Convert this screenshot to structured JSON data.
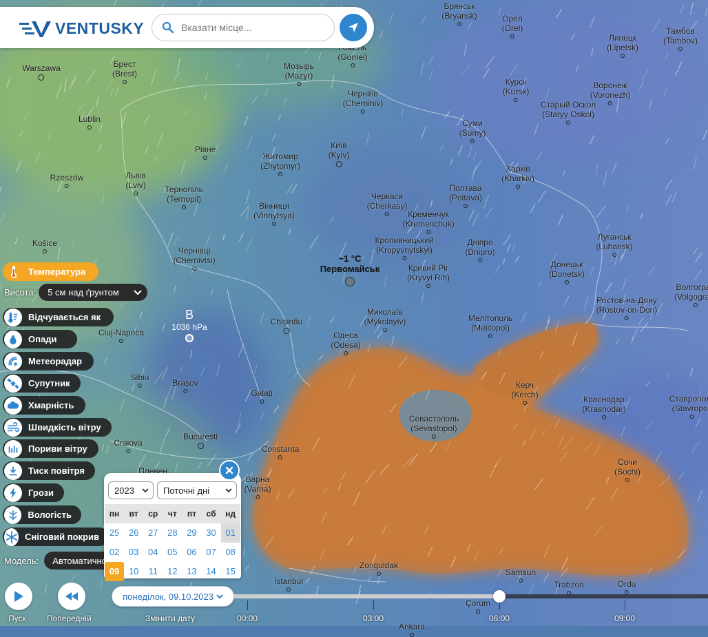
{
  "header": {
    "logo_text": "VENTUSKY",
    "search_placeholder": "Вказати місце..."
  },
  "layers": {
    "active": "Температура",
    "height_label": "Висота:",
    "height_value": "5 см над ґрунтом",
    "items": [
      {
        "label": "Відчувається як",
        "icon": "feels-like-icon"
      },
      {
        "label": "Опади",
        "icon": "precipitation-icon"
      },
      {
        "label": "Метеорадар",
        "icon": "radar-icon"
      },
      {
        "label": "Супутник",
        "icon": "satellite-icon"
      },
      {
        "label": "Хмарність",
        "icon": "cloud-icon"
      },
      {
        "label": "Швидкість вітру",
        "icon": "wind-icon"
      },
      {
        "label": "Пориви вітру",
        "icon": "gust-icon"
      },
      {
        "label": "Тиск повітря",
        "icon": "pressure-icon"
      },
      {
        "label": "Грози",
        "icon": "lightning-icon"
      },
      {
        "label": "Вологість",
        "icon": "humidity-icon"
      },
      {
        "label": "Сніговий покрив",
        "icon": "snowflake-icon"
      }
    ],
    "model_label": "Модель:",
    "model_value": "Автоматично"
  },
  "calendar": {
    "year": "2023",
    "range": "Поточні дні",
    "weekdays": [
      "пн",
      "вт",
      "ср",
      "чт",
      "пт",
      "сб",
      "нд"
    ],
    "weeks": [
      [
        "25",
        "26",
        "27",
        "28",
        "29",
        "30",
        "01"
      ],
      [
        "02",
        "03",
        "04",
        "05",
        "06",
        "07",
        "08"
      ],
      [
        "09",
        "10",
        "11",
        "12",
        "13",
        "14",
        "15"
      ]
    ],
    "today": "09"
  },
  "timeline": {
    "play_label": "Пуск",
    "prev_label": "Попередній",
    "change_date_label": "Змінити дату",
    "date": "понеділок, 09.10.2023",
    "ticks": [
      "00:00",
      "03:00",
      "06:00",
      "09:00"
    ],
    "current_position_fraction": 0.56
  },
  "map": {
    "probe_temp": "−1 °C",
    "probe_city": "Первомайськ",
    "pressure_letter": "В",
    "pressure_value": "1036 hPa",
    "cities": [
      {
        "name": "Брянськ",
        "latin": "(Bryansk)"
      },
      {
        "name": "Орёл",
        "latin": "(Orel)"
      },
      {
        "name": "Липецк",
        "latin": "(Lipetsk)"
      },
      {
        "name": "Тамбов",
        "latin": "(Tambov)"
      },
      {
        "name": "Гомель",
        "latin": "(Gomel)"
      },
      {
        "name": "Warszawa",
        "latin": ""
      },
      {
        "name": "Брест",
        "latin": "(Brest)"
      },
      {
        "name": "Мозырь",
        "latin": "(Mazyr)"
      },
      {
        "name": "Чернігів",
        "latin": "(Chernihiv)"
      },
      {
        "name": "Курск",
        "latin": "(Kursk)"
      },
      {
        "name": "Воронеж",
        "latin": "(Voronezh)"
      },
      {
        "name": "Старый Оскол",
        "latin": "(Staryy Oskol)"
      },
      {
        "name": "Суми",
        "latin": "(Sumy)"
      },
      {
        "name": "Lublin",
        "latin": ""
      },
      {
        "name": "Рівне",
        "latin": ""
      },
      {
        "name": "Житомир",
        "latin": "(Zhytomyr)"
      },
      {
        "name": "Київ",
        "latin": "(Kyiv)"
      },
      {
        "name": "Харків",
        "latin": "(Kharkiv)"
      },
      {
        "name": "Rzeszów",
        "latin": ""
      },
      {
        "name": "Львів",
        "latin": "(Lviv)"
      },
      {
        "name": "Тернопіль",
        "latin": "(Ternopil)"
      },
      {
        "name": "Черкаси",
        "latin": "(Cherkasy)"
      },
      {
        "name": "Полтава",
        "latin": "(Poltava)"
      },
      {
        "name": "Вінниця",
        "latin": "(Vinnytsya)"
      },
      {
        "name": "Кременчук",
        "latin": "(Kremenchuk)"
      },
      {
        "name": "Кропивницький",
        "latin": "(Kropyvnytskyi)"
      },
      {
        "name": "Дніпро",
        "latin": "(Dnipro)"
      },
      {
        "name": "Луганськ",
        "latin": "(Luhansk)"
      },
      {
        "name": "Košice",
        "latin": ""
      },
      {
        "name": "Чернівці",
        "latin": "(Chernivtsi)"
      },
      {
        "name": "Кривий Ріг",
        "latin": "(Kryvyi Rih)"
      },
      {
        "name": "Донецьк",
        "latin": "(Donetsk)"
      },
      {
        "name": "Волгоград",
        "latin": "(Volgograd)"
      },
      {
        "name": "Ростов-на-Дону",
        "latin": "(Rostov-on-Don)"
      },
      {
        "name": "Миколаїв",
        "latin": "(Mykolayiv)"
      },
      {
        "name": "Chișinău",
        "latin": ""
      },
      {
        "name": "Cluj-Napoca",
        "latin": ""
      },
      {
        "name": "Мелітополь",
        "latin": "(Melitopol)"
      },
      {
        "name": "Одеса",
        "latin": "(Odesa)"
      },
      {
        "name": "Sibiu",
        "latin": ""
      },
      {
        "name": "Brașov",
        "latin": ""
      },
      {
        "name": "Galați",
        "latin": ""
      },
      {
        "name": "Керч",
        "latin": "(Kerch)"
      },
      {
        "name": "Краснодар",
        "latin": "(Krasnodar)"
      },
      {
        "name": "Ставрополь",
        "latin": "(Stavropol)"
      },
      {
        "name": "Севастополь",
        "latin": "(Sevastopol)"
      },
      {
        "name": "Craiova",
        "latin": ""
      },
      {
        "name": "București",
        "latin": ""
      },
      {
        "name": "Constanta",
        "latin": ""
      },
      {
        "name": "Сочи",
        "latin": "(Sochi)"
      },
      {
        "name": "Плевен",
        "latin": ""
      },
      {
        "name": "Варна",
        "latin": "(Varna)"
      },
      {
        "name": "Zonguldak",
        "latin": ""
      },
      {
        "name": "Samsun",
        "latin": ""
      },
      {
        "name": "Trabzon",
        "latin": ""
      },
      {
        "name": "Ordu",
        "latin": ""
      },
      {
        "name": "İstanbul",
        "latin": ""
      },
      {
        "name": "Çorum",
        "latin": ""
      },
      {
        "name": "Ankara",
        "latin": ""
      }
    ]
  },
  "colors": {
    "accent": "#2e86cf",
    "active_layer": "#f5a623",
    "sea_warm": "#c57a3a",
    "land_cool": "#5a86b8"
  }
}
